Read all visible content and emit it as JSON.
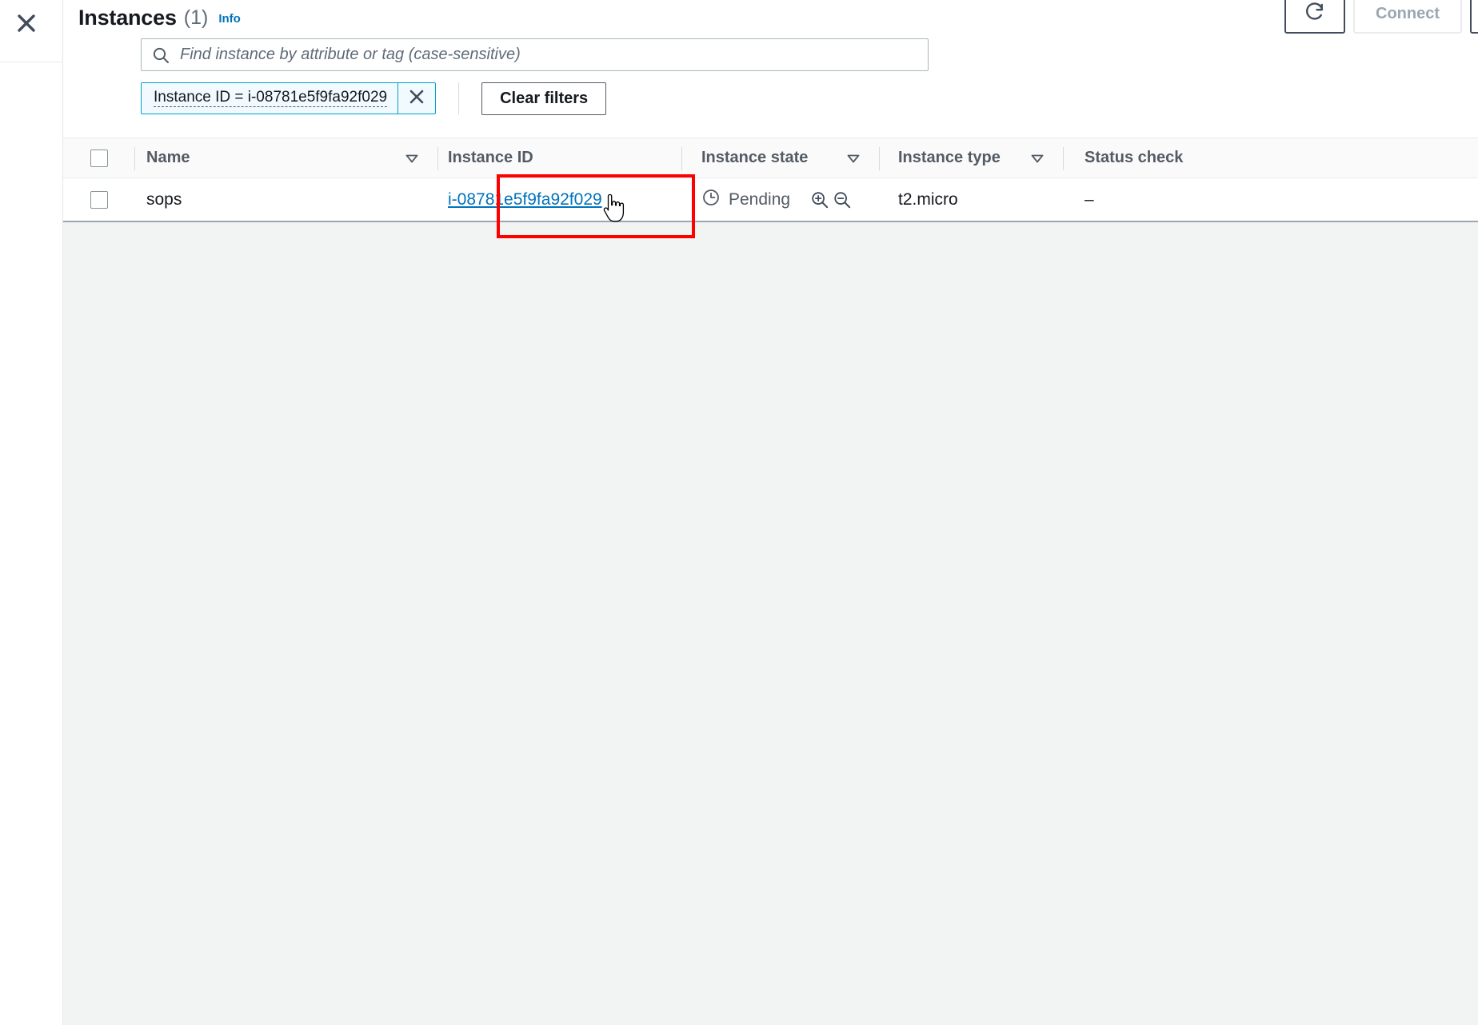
{
  "left_rail": {
    "close_icon": "close-icon"
  },
  "header": {
    "title": "Instances",
    "count": "(1)",
    "info_label": "Info"
  },
  "top_actions": {
    "refresh_icon": "refresh-icon",
    "connect_label": "Connect"
  },
  "search": {
    "icon": "search-icon",
    "placeholder": "Find instance by attribute or tag (case-sensitive)",
    "value": ""
  },
  "filters": {
    "chip": {
      "text": "Instance ID = i-08781e5f9fa92f029",
      "dismiss_icon": "close-icon"
    },
    "clear_label": "Clear filters"
  },
  "table": {
    "columns": [
      {
        "label": "Name",
        "sortable": true
      },
      {
        "label": "Instance ID",
        "sortable": false
      },
      {
        "label": "Instance state",
        "sortable": true
      },
      {
        "label": "Instance type",
        "sortable": true
      },
      {
        "label": "Status check",
        "sortable": false
      }
    ],
    "rows": [
      {
        "name": "sops",
        "instance_id": "i-08781e5f9fa92f029",
        "instance_state": "Pending",
        "state_icon": "clock-icon",
        "instance_type": "t2.micro",
        "status_check": "–"
      }
    ]
  },
  "colors": {
    "link": "#0073bb",
    "chip_border": "#00a1c9",
    "chip_bg": "#f1faff",
    "highlight": "#ff0000",
    "header_text": "#545b64",
    "page_bg": "#f2f3f3"
  }
}
